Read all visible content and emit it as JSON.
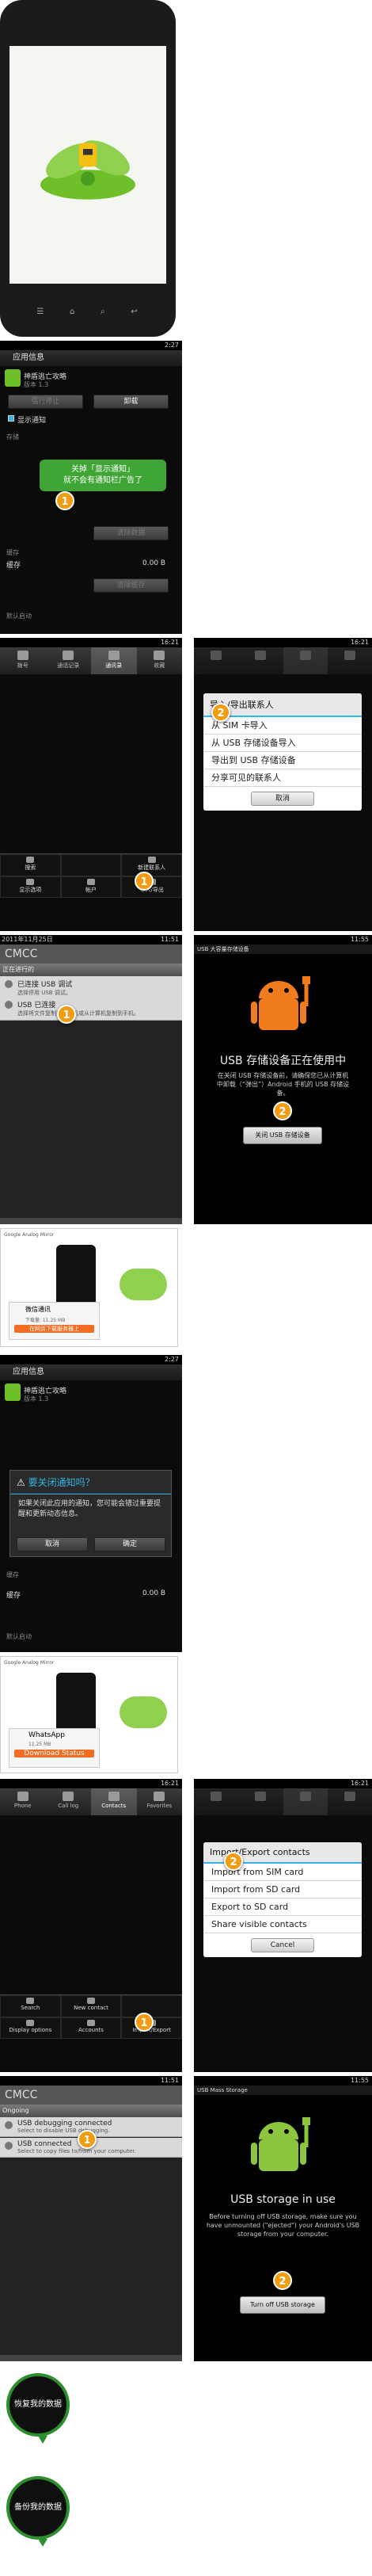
{
  "phone": {
    "brand_color": "#1a1a1a"
  },
  "app_info_cn": {
    "status_time": "2:27",
    "title": "应用信息",
    "app_name": "神盾逃亡攻略",
    "app_version": "版本 1.3",
    "force_stop": "强行停止",
    "uninstall": "卸载",
    "show_notifications": "显示通知",
    "storage": "存储",
    "clear_data": "清除数据",
    "cache": "缓存",
    "cache_value": "0.00 B",
    "clear_cache": "清除缓存",
    "default_launch": "默认启动",
    "tip": "关掉「显示通知」\n就不会有通知栏广告了",
    "badge": "1"
  },
  "contacts_cn": {
    "time": "16:21",
    "tabs": [
      "拨号",
      "通话记录",
      "通讯录",
      "收藏"
    ],
    "menu": [
      "搜索",
      "",
      "新建联系人",
      "显示选项",
      "帐户",
      "导入/导出"
    ],
    "badge": "1"
  },
  "import_cn": {
    "time": "16:21",
    "title": "导入/导出联系人",
    "options": [
      "从 SIM 卡导入",
      "从 USB 存储设备导入",
      "导出到 USB 存储设备",
      "分享可见的联系人"
    ],
    "cancel": "取消",
    "badge": "2"
  },
  "usb_notif_cn": {
    "time": "11:51",
    "date": "2011年11月25日",
    "carrier": "CMCC",
    "ongoing": "正在进行的",
    "item1_title": "已连接 USB 调试",
    "item1_sub": "选择停用 USB 调试。",
    "item2_title": "USB 已连接",
    "item2_sub": "选择将文件复制到计算机或从计算机复制到手机。",
    "badge": "1"
  },
  "usb_storage_cn": {
    "time": "11:55",
    "title": "USB 大容量存储设备",
    "heading": "USB 存储设备正在使用中",
    "body": "在关闭 USB 存储设备前，请确保您已从计算机中卸载（“弹出”）Android 手机的 USB 存储设备。",
    "button": "关闭 USB 存储设备",
    "badge": "2"
  },
  "ad_cn": {
    "banner": "Google Analog Mirror",
    "item_title": "微信通讯",
    "item_sub": "下载量: 11.25 MB",
    "btn": "在网页下载服务器上"
  },
  "app_info_cn2": {
    "status_time": "2:27",
    "title": "应用信息",
    "app_name": "神盾逃亡攻略",
    "app_version": "版本 1.3",
    "dialog_title": "要关闭通知吗？",
    "dialog_body": "如果关闭此应用的通知，您可能会错过重要提醒和更新动态信息。",
    "cancel": "取消",
    "ok": "确定",
    "storage": "存储",
    "cache": "缓存",
    "cache_value": "0.00 B",
    "default_launch": "默认启动"
  },
  "ad_en": {
    "banner": "Google Analog Mirror",
    "app": "WhatsApp",
    "sub": "11.25 MB",
    "status": "Download Status"
  },
  "contacts_en": {
    "time": "16:21",
    "tabs": [
      "Phone",
      "Call log",
      "Contacts",
      "Favorites"
    ],
    "menu": [
      "Search",
      "New contact",
      "",
      "Display options",
      "Accounts",
      "Import/Export"
    ],
    "badge": "1"
  },
  "import_en": {
    "time": "16:21",
    "title": "Import/Export contacts",
    "options": [
      "Import from SIM card",
      "Import from SD card",
      "Export to SD card",
      "Share visible contacts"
    ],
    "cancel": "Cancel",
    "badge": "2"
  },
  "usb_notif_en": {
    "time": "11:51",
    "carrier": "CMCC",
    "ongoing": "Ongoing",
    "item1_title": "USB debugging connected",
    "item1_sub": "Select to disable USB debugging.",
    "item2_title": "USB connected",
    "item2_sub": "Select to copy files to/from your computer.",
    "badge": "1"
  },
  "usb_storage_en": {
    "time": "11:55",
    "title": "USB Mass Storage",
    "heading": "USB storage in use",
    "body": "Before turning off USB storage, make sure you have unmounted (\"ejected\") your Android's USB storage from your computer.",
    "button": "Turn off USB storage",
    "badge": "2"
  },
  "bubbles": [
    "恢复我的数据",
    "备份我的数据"
  ]
}
